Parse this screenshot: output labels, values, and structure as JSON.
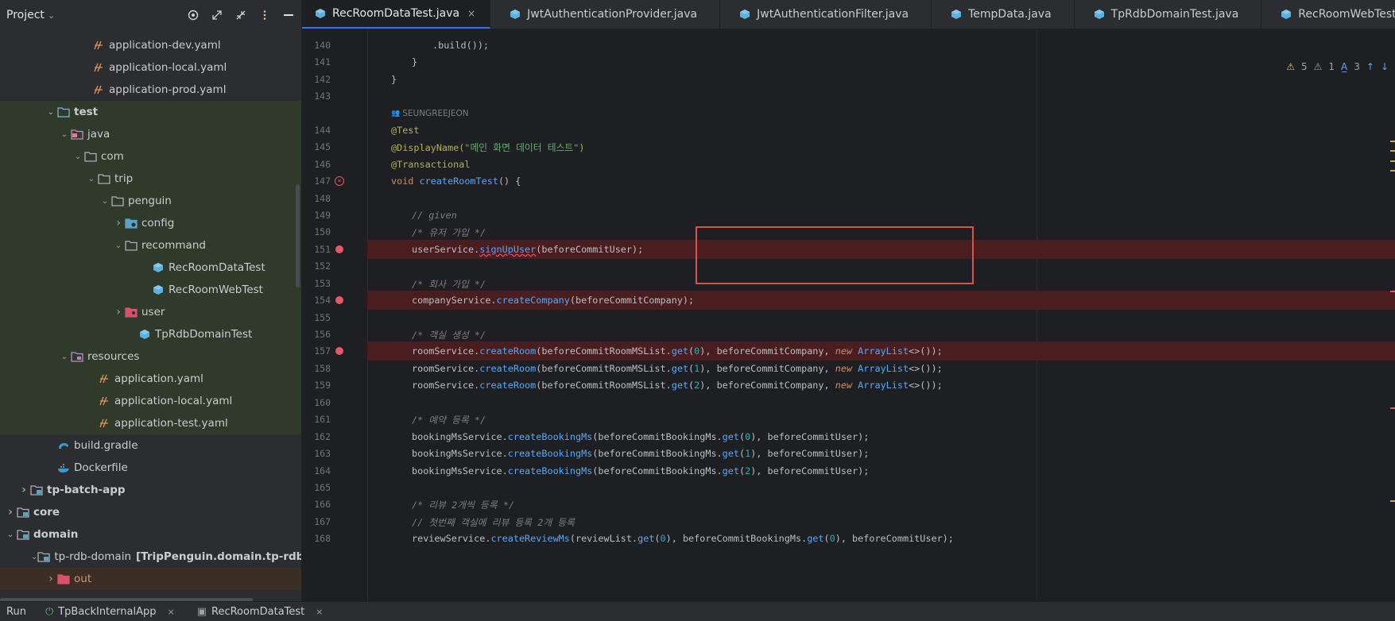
{
  "project_header": {
    "title": "Project"
  },
  "tree": [
    {
      "label": "application-dev.yaml",
      "indent": 112,
      "icon": "yaml",
      "arrow": "",
      "bg": ""
    },
    {
      "label": "application-local.yaml",
      "indent": 112,
      "icon": "yaml",
      "arrow": "",
      "bg": ""
    },
    {
      "label": "application-prod.yaml",
      "indent": 112,
      "icon": "yaml",
      "arrow": "",
      "bg": ""
    },
    {
      "label": "test",
      "indent": 68,
      "icon": "folder-test",
      "arrow": "down",
      "bg": "test",
      "bold": true
    },
    {
      "label": "java",
      "indent": 85,
      "icon": "folder-src",
      "arrow": "down",
      "bg": "test"
    },
    {
      "label": "com",
      "indent": 102,
      "icon": "folder",
      "arrow": "down",
      "bg": "test"
    },
    {
      "label": "trip",
      "indent": 119,
      "icon": "folder",
      "arrow": "down",
      "bg": "test"
    },
    {
      "label": "penguin",
      "indent": 136,
      "icon": "folder",
      "arrow": "down",
      "bg": "test"
    },
    {
      "label": "config",
      "indent": 153,
      "icon": "folder-config",
      "arrow": "right",
      "bg": "test"
    },
    {
      "label": "recommand",
      "indent": 153,
      "icon": "folder",
      "arrow": "down",
      "bg": "test"
    },
    {
      "label": "RecRoomDataTest",
      "indent": 187,
      "icon": "class",
      "arrow": "",
      "bg": "test",
      "selected": true
    },
    {
      "label": "RecRoomWebTest",
      "indent": 187,
      "icon": "class",
      "arrow": "",
      "bg": "test"
    },
    {
      "label": "user",
      "indent": 153,
      "icon": "folder-user",
      "arrow": "right",
      "bg": "test"
    },
    {
      "label": "TpRdbDomainTest",
      "indent": 170,
      "icon": "class",
      "arrow": "",
      "bg": "test"
    },
    {
      "label": "resources",
      "indent": 85,
      "icon": "folder-res",
      "arrow": "down",
      "bg": "test"
    },
    {
      "label": "application.yaml",
      "indent": 119,
      "icon": "yaml",
      "arrow": "",
      "bg": "test"
    },
    {
      "label": "application-local.yaml",
      "indent": 119,
      "icon": "yaml",
      "arrow": "",
      "bg": "test"
    },
    {
      "label": "application-test.yaml",
      "indent": 119,
      "icon": "yaml",
      "arrow": "",
      "bg": "test"
    },
    {
      "label": "build.gradle",
      "indent": 68,
      "icon": "gradle",
      "arrow": "",
      "bg": ""
    },
    {
      "label": "Dockerfile",
      "indent": 68,
      "icon": "docker",
      "arrow": "",
      "bg": ""
    },
    {
      "label": "tp-batch-app",
      "indent": 34,
      "icon": "module",
      "arrow": "right",
      "bg": "",
      "bold": true
    },
    {
      "label": "core",
      "indent": 17,
      "icon": "module",
      "arrow": "right",
      "bg": "",
      "bold": true
    },
    {
      "label": "domain",
      "indent": 17,
      "icon": "module",
      "arrow": "down",
      "bg": "",
      "bold": true
    },
    {
      "label": "tp-rdb-domain",
      "extra": "[TripPenguin.domain.tp-rdb-domain]",
      "indent": 51,
      "icon": "module",
      "arrow": "down",
      "bg": ""
    },
    {
      "label": "out",
      "indent": 68,
      "icon": "folder-out",
      "arrow": "right",
      "bg": "out"
    }
  ],
  "tabs": [
    {
      "label": "RecRoomDataTest.java",
      "active": true,
      "close": "×"
    },
    {
      "label": "JwtAuthenticationProvider.java"
    },
    {
      "label": "JwtAuthenticationFilter.java"
    },
    {
      "label": "TempData.java"
    },
    {
      "label": "TpRdbDomainTest.java"
    },
    {
      "label": "RecRoomWebTest.java"
    }
  ],
  "inspections": {
    "warnings": "5",
    "weak": "1",
    "typos": "3"
  },
  "author_hint": "SEUNGREEJEON",
  "code": {
    "l140": ".build());",
    "l141": "}",
    "l142": "}",
    "l144": "@Test",
    "l145_a": "@DisplayName(",
    "l145_s": "\"메인 화면 데이터 테스트\"",
    "l145_b": ")",
    "l146": "@Transactional",
    "l147_kw": "void ",
    "l147_fn": "createRoomTest",
    "l147_b": "() {",
    "l149": "// given",
    "l150": "/* 유저 가입 */",
    "l151_a": "userService.",
    "l151_fn": "signUpUser",
    "l151_b": "(beforeCommitUser);",
    "l153": "/* 회사 가입 */",
    "l154_a": "companyService.",
    "l154_fn": "createCompany",
    "l154_b": "(beforeCommitCompany);",
    "l156": "/* 객실 생성 */",
    "room_a": "roomService.",
    "room_fn": "createRoom",
    "room_b": "(beforeCommitRoomMSList.",
    "get": "get",
    "room_c": "), beforeCommitCompany, ",
    "new": "new ",
    "arraylist": "ArrayList",
    "room_d": "<>());",
    "l161": "/* 예약 등록 */",
    "bk_a": "bookingMsService.",
    "bk_fn": "createBookingMs",
    "bk_b": "(beforeCommitBookingMs.",
    "bk_c": "), beforeCommitUser);",
    "l166": "/* 리뷰 2개씩 등록 */",
    "l167": "// 첫번째 객실에 리뷰 등록 2개 등록",
    "rv_a": "reviewService.",
    "rv_fn": "createReviewMs",
    "rv_b": "(reviewList.",
    "rv_c": "), beforeCommitBookingMs.",
    "rv_d": "), beforeCommitUser);",
    "n0": "0",
    "n1": "1",
    "n2": "2",
    "p_open": "("
  },
  "line_numbers": [
    "140",
    "141",
    "142",
    "143",
    "",
    "144",
    "145",
    "146",
    "147",
    "148",
    "149",
    "150",
    "151",
    "152",
    "153",
    "154",
    "155",
    "156",
    "157",
    "158",
    "159",
    "160",
    "161",
    "162",
    "163",
    "164",
    "165",
    "166",
    "167",
    "168"
  ],
  "bottom_bar": {
    "run": "Run",
    "tab1": "TpBackInternalApp",
    "tab2": "RecRoomDataTest",
    "x": "×"
  }
}
